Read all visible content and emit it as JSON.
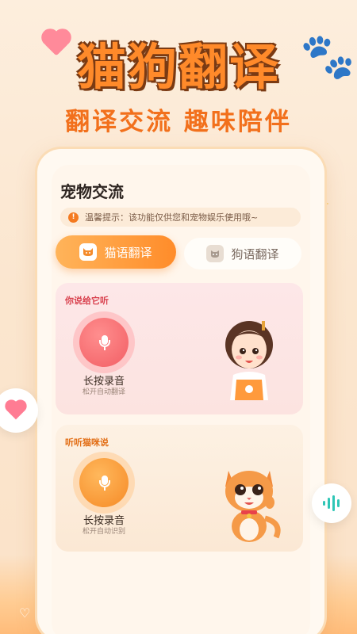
{
  "header": {
    "title": "猫狗翻译",
    "subtitle": "翻译交流 趣味陪伴"
  },
  "main": {
    "section_title": "宠物交流",
    "notice_icon": "!",
    "notice_text": "温馨提示：该功能仅供您和宠物娱乐使用哦~",
    "tabs": [
      {
        "label": "猫语翻译",
        "active": true,
        "icon": "cat-face-icon"
      },
      {
        "label": "狗语翻译",
        "active": false,
        "icon": "dog-face-icon"
      }
    ],
    "cards": {
      "you": {
        "label": "你说给它听",
        "hold_text": "长按录音",
        "sub_text": "松开自动翻译"
      },
      "cat": {
        "label": "听听猫咪说",
        "hold_text": "长按录音",
        "sub_text": "松开自动识别"
      }
    }
  },
  "colors": {
    "accent": "#ff8a2a",
    "title_outline": "#7a3a13",
    "pink_mic": "#f25e64",
    "orange_mic": "#f68a26"
  }
}
